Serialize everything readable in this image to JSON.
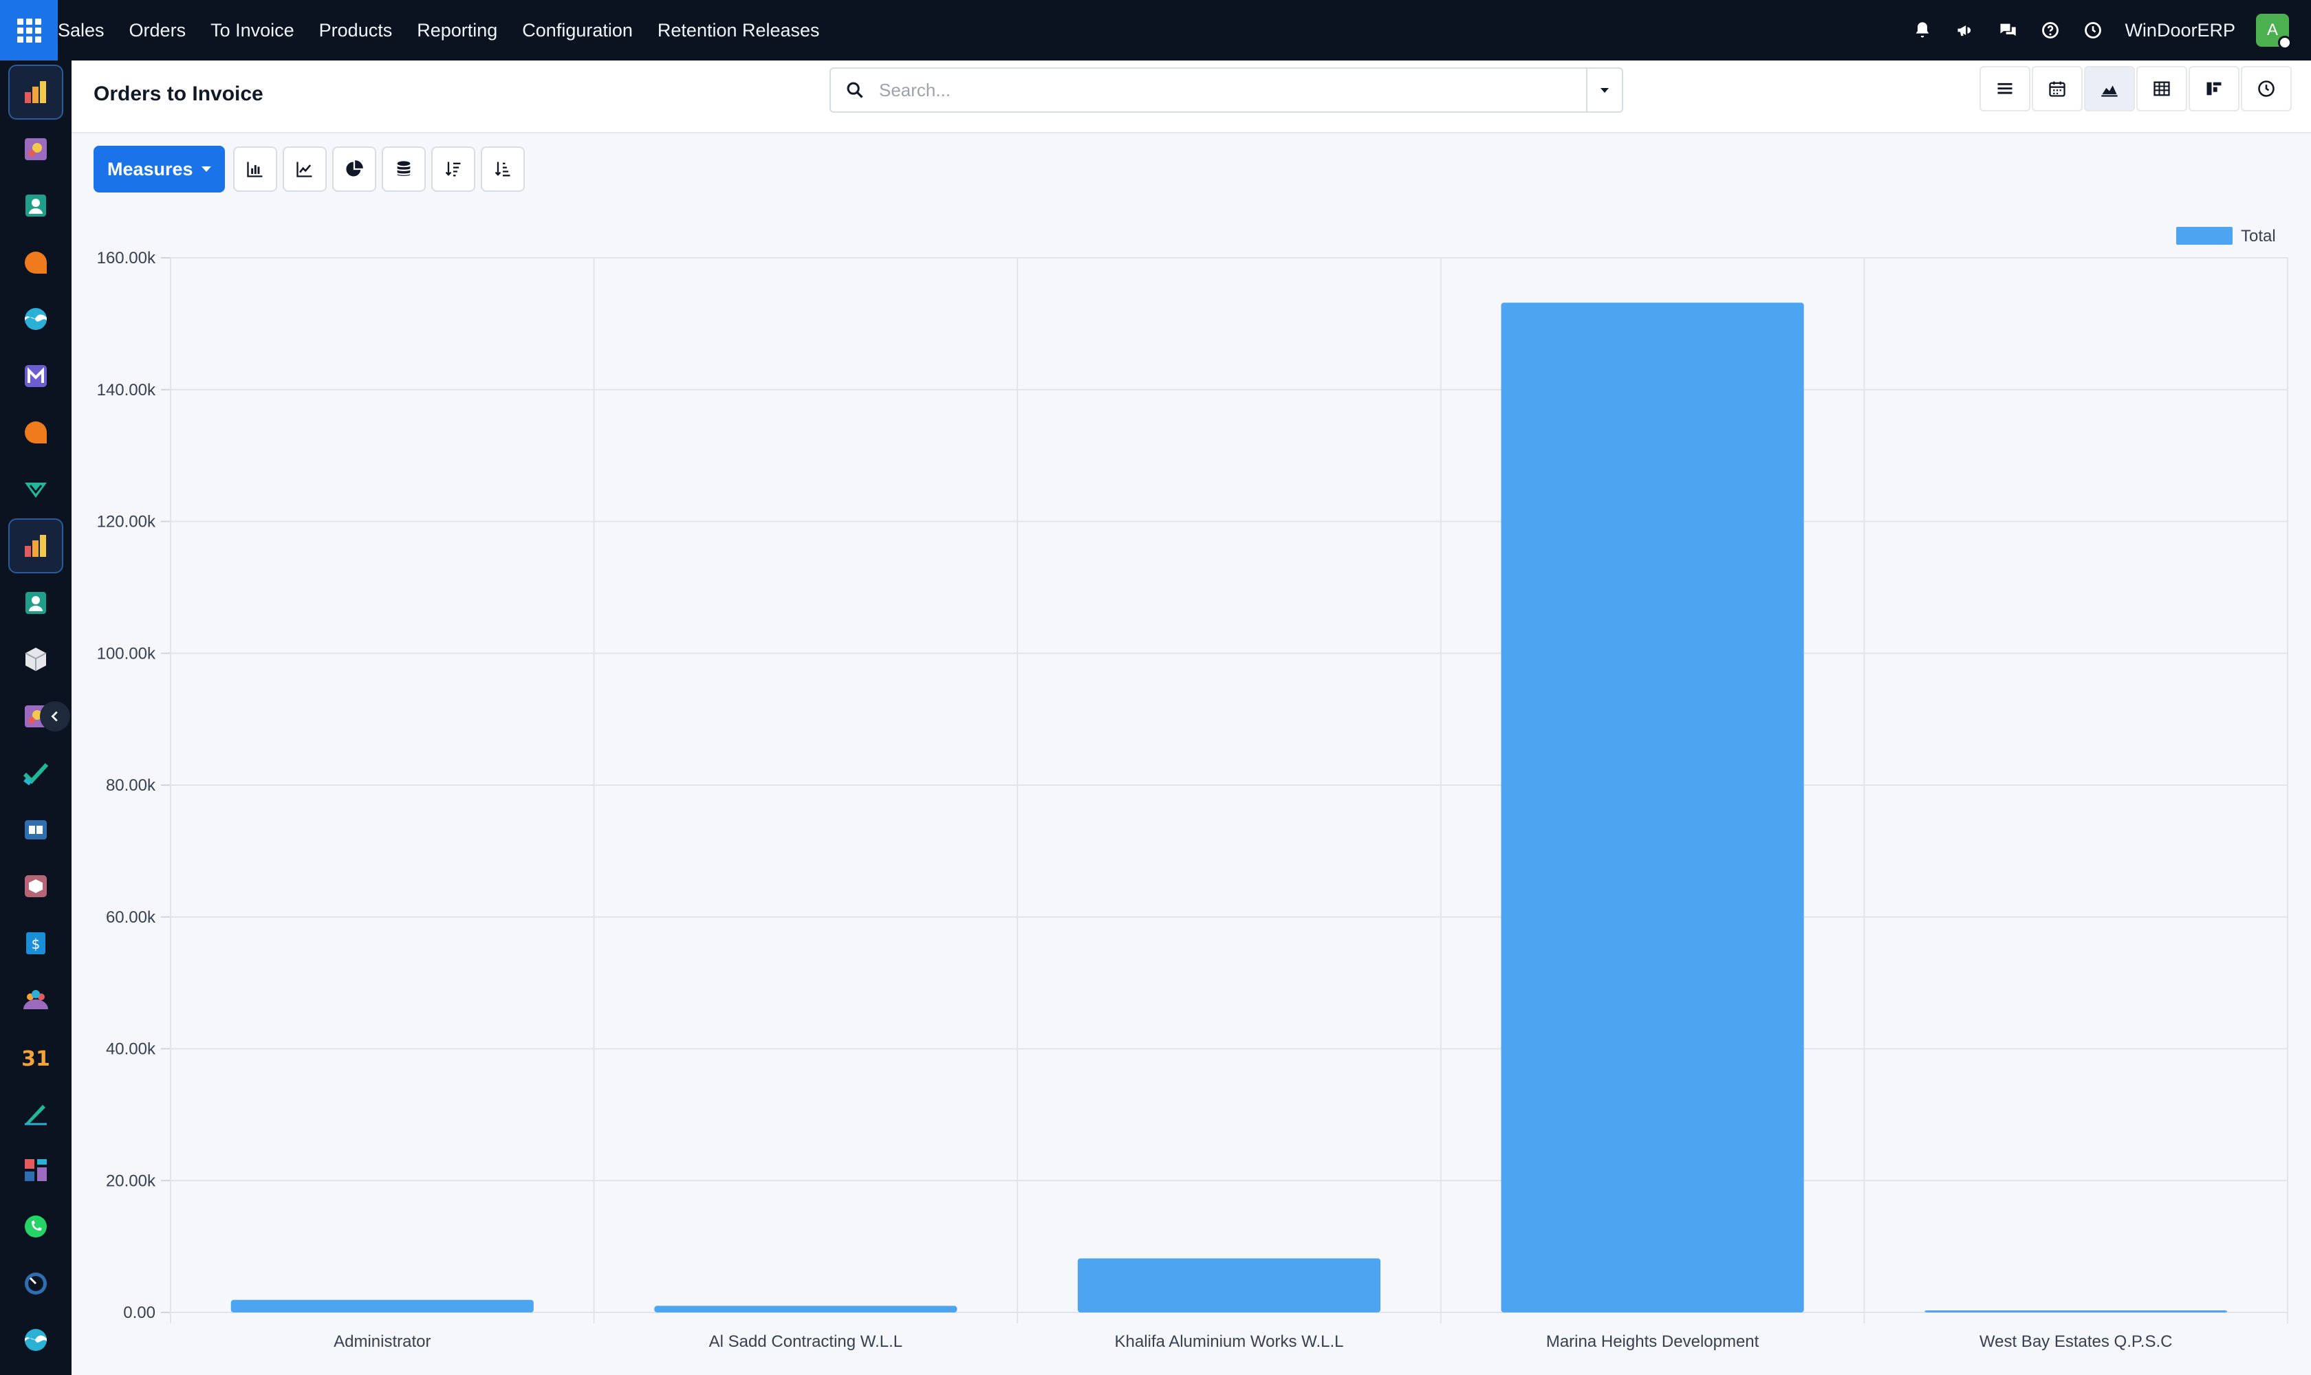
{
  "nav": {
    "menu": [
      "Sales",
      "Orders",
      "To Invoice",
      "Products",
      "Reporting",
      "Configuration",
      "Retention Releases"
    ],
    "company": "WinDoorERP",
    "avatar_letter": "A"
  },
  "panel": {
    "title": "Orders to Invoice",
    "search_placeholder": "Search..."
  },
  "toolbar": {
    "measures_label": "Measures"
  },
  "colors": {
    "accent": "#1a73e8",
    "bar": "#4da5f2",
    "topbar": "#0b1220"
  },
  "chart_data": {
    "type": "bar",
    "categories": [
      "Administrator",
      "Al Sadd Contracting W.L.L",
      "Khalifa Aluminium Works W.L.L",
      "Marina Heights Development",
      "West Bay Estates Q.P.S.C"
    ],
    "series": [
      {
        "name": "Total",
        "values": [
          1900,
          1000,
          8200,
          153200,
          300
        ]
      }
    ],
    "yticks": [
      "0.00",
      "20.00k",
      "40.00k",
      "60.00k",
      "80.00k",
      "100.00k",
      "120.00k",
      "140.00k",
      "160.00k"
    ],
    "ylim": [
      0,
      160000
    ],
    "grid": true,
    "legend": "top-right"
  }
}
